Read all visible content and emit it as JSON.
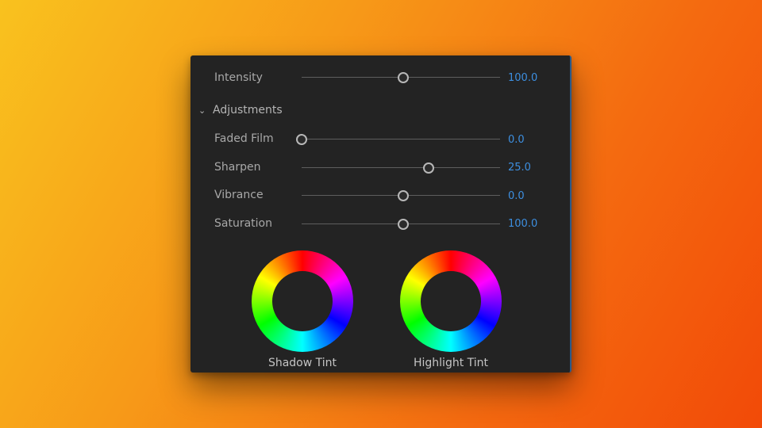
{
  "panel": {
    "intensity": {
      "label": "Intensity",
      "value": "100.0",
      "fraction": 0.51
    },
    "adjustments": {
      "label": "Adjustments",
      "chevron_icon": "chevron-down-icon"
    },
    "sliders": [
      {
        "label": "Faded Film",
        "value": "0.0",
        "fraction": 0.0
      },
      {
        "label": "Sharpen",
        "value": "25.0",
        "fraction": 0.64
      },
      {
        "label": "Vibrance",
        "value": "0.0",
        "fraction": 0.51
      },
      {
        "label": "Saturation",
        "value": "100.0",
        "fraction": 0.51
      }
    ],
    "wheels": [
      {
        "label": "Shadow Tint"
      },
      {
        "label": "Highlight Tint"
      }
    ]
  },
  "colors": {
    "value_blue": "#3d8fe0",
    "panel_bg": "#232323"
  }
}
